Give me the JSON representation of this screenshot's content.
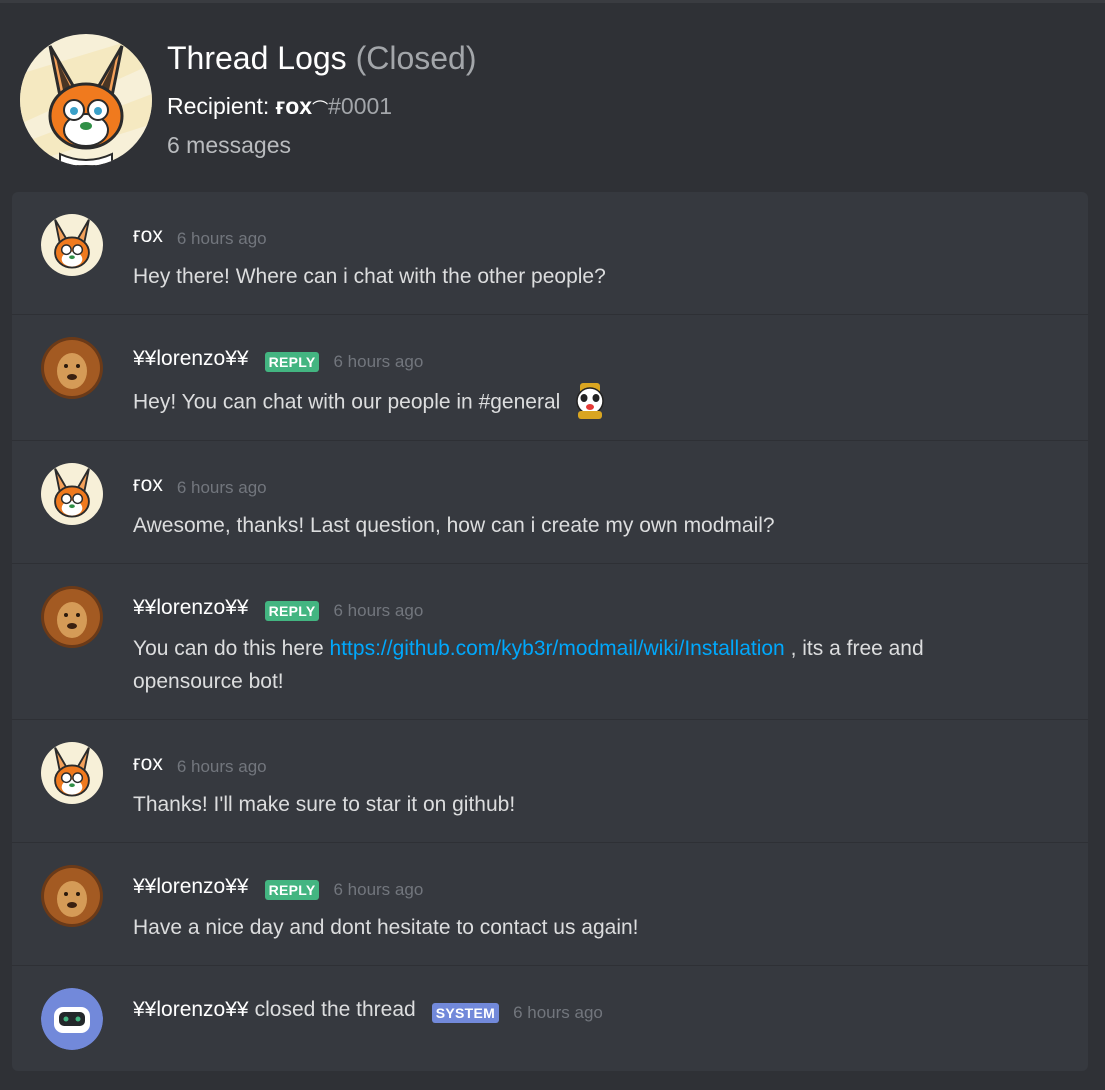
{
  "header": {
    "title": "Thread Logs",
    "status": "(Closed)",
    "recipient_label": "Recipient:",
    "recipient_name": "ғox",
    "recipient_discriminator": "#0001",
    "message_count": "6 messages",
    "avatar_icon": "fox-avatar-icon"
  },
  "messages": [
    {
      "author": "ғox",
      "badge": "",
      "time": "6 hours ago",
      "text": "Hey there! Where can i chat with the other people?",
      "avatar_icon": "fox-avatar-icon"
    },
    {
      "author": "¥¥lorenzo¥¥",
      "badge": "REPLY",
      "time": "6 hours ago",
      "text": "Hey! You can chat with our people in #general",
      "avatar_icon": "lion-avatar-icon",
      "emoji_icon": "panda-emoji-icon"
    },
    {
      "author": "ғox",
      "badge": "",
      "time": "6 hours ago",
      "text": "Awesome, thanks! Last question, how can i create my own modmail?",
      "avatar_icon": "fox-avatar-icon"
    },
    {
      "author": "¥¥lorenzo¥¥",
      "badge": "REPLY",
      "time": "6 hours ago",
      "text_before": "You can do this here",
      "link": "https://github.com/kyb3r/modmail/wiki/Installation",
      "text_after": ", its a free and opensource bot!",
      "avatar_icon": "lion-avatar-icon"
    },
    {
      "author": "ғox",
      "badge": "",
      "time": "6 hours ago",
      "text": "Thanks! I'll make sure to star it on github!",
      "avatar_icon": "fox-avatar-icon"
    },
    {
      "author": "¥¥lorenzo¥¥",
      "badge": "REPLY",
      "time": "6 hours ago",
      "text": "Have a nice day and dont hesitate to contact us again!",
      "avatar_icon": "lion-avatar-icon"
    },
    {
      "author": "¥¥lorenzo¥¥",
      "action": "closed the thread",
      "badge": "SYSTEM",
      "time": "6 hours ago",
      "avatar_icon": "bot-avatar-icon"
    }
  ],
  "colors": {
    "background": "#2f3136",
    "panel": "#36393f",
    "reply_badge": "#43b581",
    "system_badge": "#7289da",
    "link": "#00a8fc",
    "timestamp": "#72767d"
  }
}
